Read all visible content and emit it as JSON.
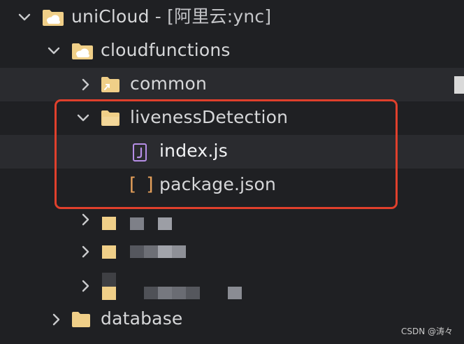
{
  "tree": {
    "root": {
      "name": "uniCloud",
      "suffix": " - [阿里云:ync]"
    },
    "cloudfunctions": {
      "name": "cloudfunctions"
    },
    "common": {
      "name": "common"
    },
    "liveness": {
      "name": "livenessDetection"
    },
    "index_js": {
      "name": "index.js"
    },
    "package_json": {
      "name": "package.json",
      "icon_glyph": "[ ]"
    },
    "database": {
      "name": "database"
    }
  },
  "colors": {
    "folder": "#f0cf88",
    "cloud_folder": "#f0cf88",
    "js_icon": "#b68ee6",
    "json_icon": "#e8a25b",
    "highlight_border": "#e0402c"
  },
  "watermark": "CSDN @涛々"
}
